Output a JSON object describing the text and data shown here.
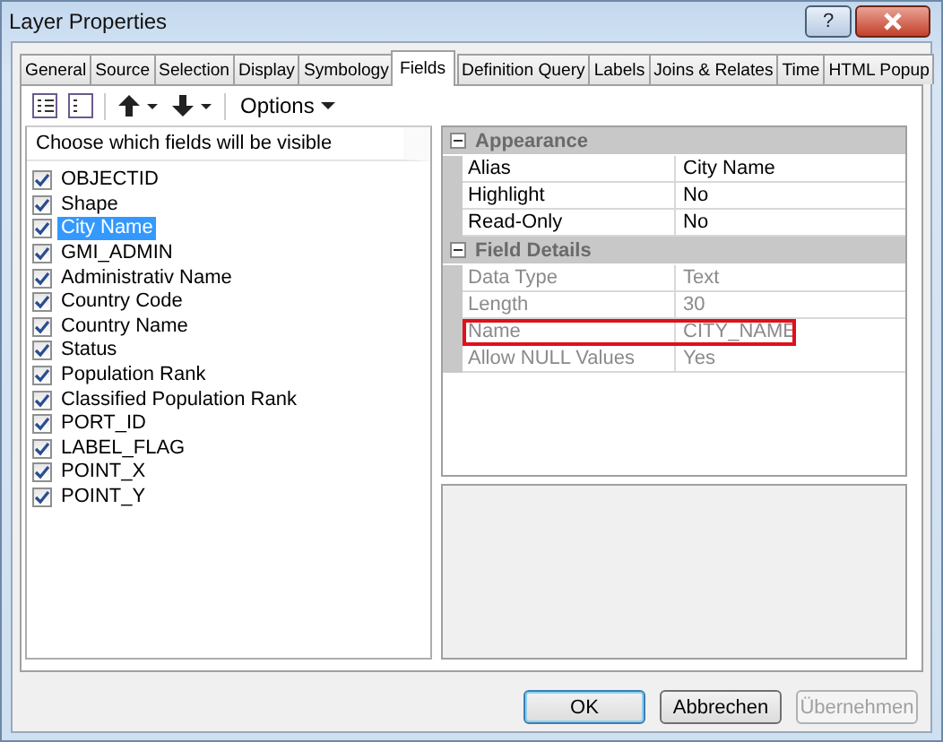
{
  "window": {
    "title": "Layer Properties",
    "help_button": "?"
  },
  "tabs": [
    {
      "label": "General",
      "selected": false
    },
    {
      "label": "Source",
      "selected": false
    },
    {
      "label": "Selection",
      "selected": false
    },
    {
      "label": "Display",
      "selected": false
    },
    {
      "label": "Symbology",
      "selected": false
    },
    {
      "label": "Fields",
      "selected": true
    },
    {
      "label": "Definition Query",
      "selected": false
    },
    {
      "label": "Labels",
      "selected": false
    },
    {
      "label": "Joins & Relates",
      "selected": false
    },
    {
      "label": "Time",
      "selected": false
    },
    {
      "label": "HTML Popup",
      "selected": false
    }
  ],
  "toolbar": {
    "options_label": "Options"
  },
  "field_list": {
    "header": "Choose which fields will be visible",
    "items": [
      {
        "label": "OBJECTID",
        "checked": true,
        "selected": false
      },
      {
        "label": "Shape",
        "checked": true,
        "selected": false
      },
      {
        "label": "City Name",
        "checked": true,
        "selected": true
      },
      {
        "label": "GMI_ADMIN",
        "checked": true,
        "selected": false
      },
      {
        "label": "Administrativ Name",
        "checked": true,
        "selected": false
      },
      {
        "label": "Country Code",
        "checked": true,
        "selected": false
      },
      {
        "label": "Country Name",
        "checked": true,
        "selected": false
      },
      {
        "label": "Status",
        "checked": true,
        "selected": false
      },
      {
        "label": "Population Rank",
        "checked": true,
        "selected": false
      },
      {
        "label": "Classified Population Rank",
        "checked": true,
        "selected": false
      },
      {
        "label": "PORT_ID",
        "checked": true,
        "selected": false
      },
      {
        "label": "LABEL_FLAG",
        "checked": true,
        "selected": false
      },
      {
        "label": "POINT_X",
        "checked": true,
        "selected": false
      },
      {
        "label": "POINT_Y",
        "checked": true,
        "selected": false
      }
    ]
  },
  "properties": {
    "groups": [
      {
        "title": "Appearance",
        "expanded": true,
        "rows": [
          {
            "name": "Alias",
            "value": "City Name",
            "disabled": false,
            "highlighted": false
          },
          {
            "name": "Highlight",
            "value": "No",
            "disabled": false,
            "highlighted": false
          },
          {
            "name": "Read-Only",
            "value": "No",
            "disabled": false,
            "highlighted": false
          }
        ]
      },
      {
        "title": "Field Details",
        "expanded": true,
        "rows": [
          {
            "name": "Data Type",
            "value": "Text",
            "disabled": true,
            "highlighted": false
          },
          {
            "name": "Length",
            "value": "30",
            "disabled": true,
            "highlighted": false
          },
          {
            "name": "Name",
            "value": "CITY_NAME",
            "disabled": true,
            "highlighted": true
          },
          {
            "name": "Allow NULL Values",
            "value": "Yes",
            "disabled": true,
            "highlighted": false
          }
        ]
      }
    ]
  },
  "buttons": [
    {
      "label": "OK",
      "default": true,
      "disabled": false
    },
    {
      "label": "Abbrechen",
      "default": false,
      "disabled": false
    },
    {
      "label": "Übernehmen",
      "default": false,
      "disabled": true
    }
  ]
}
